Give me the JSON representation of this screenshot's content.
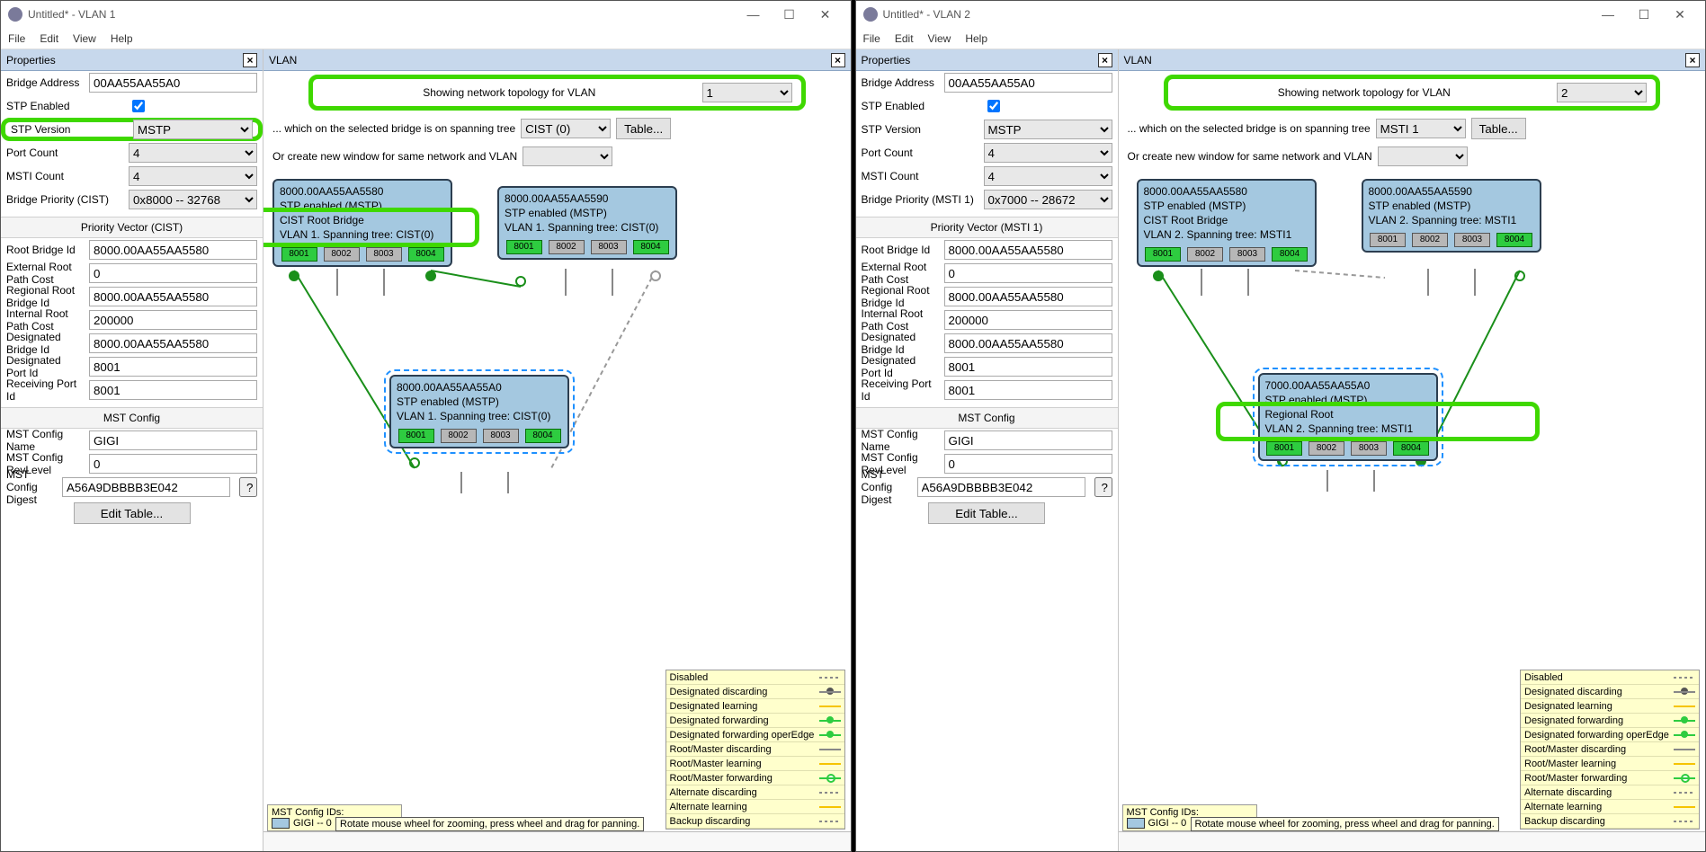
{
  "screens": [
    {
      "title": "Untitled* - VLAN 1",
      "menu": [
        "File",
        "Edit",
        "View",
        "Help"
      ],
      "props_title": "Properties",
      "props": {
        "bridge_address_lbl": "Bridge Address",
        "bridge_address": "00AA55AA55A0",
        "stp_enabled_lbl": "STP Enabled",
        "stp_enabled": true,
        "stp_version_lbl": "STP Version",
        "stp_version": "MSTP",
        "port_count_lbl": "Port Count",
        "port_count": "4",
        "msti_count_lbl": "MSTI Count",
        "msti_count": "4",
        "bridge_priority_lbl": "Bridge Priority (CIST)",
        "bridge_priority": "0x8000 -- 32768",
        "pv_hdr": "Priority Vector (CIST)",
        "root_bridge_id_lbl": "Root Bridge Id",
        "root_bridge_id": "8000.00AA55AA5580",
        "ext_root_path_lbl": "External Root Path Cost",
        "ext_root_path": "0",
        "reg_root_id_lbl": "Regional Root Bridge Id",
        "reg_root_id": "8000.00AA55AA5580",
        "int_root_path_lbl": "Internal Root Path Cost",
        "int_root_path": "200000",
        "desig_bridge_lbl": "Designated Bridge Id",
        "desig_bridge": "8000.00AA55AA5580",
        "desig_port_lbl": "Designated Port Id",
        "desig_port": "8001",
        "recv_port_lbl": "Receiving Port Id",
        "recv_port": "8001",
        "mst_hdr": "MST Config",
        "mst_name_lbl": "MST Config Name",
        "mst_name": "GIGI",
        "mst_rev_lbl": "MST Config RevLevel",
        "mst_rev": "0",
        "mst_digest_lbl": "MST Config Digest",
        "mst_digest": "A56A9DBBBB3E042",
        "edit_table": "Edit Table..."
      },
      "vlan_title": "VLAN",
      "vlan_top": {
        "showing": "Showing network topology for VLAN",
        "vlan_sel": "1",
        "which": "... which on the selected bridge is on spanning tree",
        "tree_sel": "CIST (0)",
        "table_btn": "Table...",
        "orcreate": "Or create new window for same network and VLAN"
      },
      "nodes": {
        "n1": {
          "id": "8000.00AA55AA5580",
          "stp": "STP enabled (MSTP)",
          "role": "CIST Root Bridge",
          "span": "VLAN 1. Spanning tree: CIST(0)",
          "ports": [
            "8001",
            "8002",
            "8003",
            "8004"
          ],
          "green": [
            0,
            3
          ]
        },
        "n2": {
          "id": "8000.00AA55AA5590",
          "stp": "STP enabled (MSTP)",
          "span": "VLAN 1. Spanning tree: CIST(0)",
          "ports": [
            "8001",
            "8002",
            "8003",
            "8004"
          ],
          "green": [
            0,
            3
          ]
        },
        "n3": {
          "id": "8000.00AA55AA55A0",
          "stp": "STP enabled (MSTP)",
          "span": "VLAN 1. Spanning tree: CIST(0)",
          "ports": [
            "8001",
            "8002",
            "8003",
            "8004"
          ],
          "green": [
            0,
            3
          ]
        }
      },
      "mst_ids_hdr": "MST Config IDs:",
      "mst_ids_item": "GIGI -- 0",
      "tooltip": "Rotate mouse wheel for zooming, press wheel and drag for panning."
    },
    {
      "title": "Untitled* - VLAN 2",
      "menu": [
        "File",
        "Edit",
        "View",
        "Help"
      ],
      "props_title": "Properties",
      "props": {
        "bridge_address_lbl": "Bridge Address",
        "bridge_address": "00AA55AA55A0",
        "stp_enabled_lbl": "STP Enabled",
        "stp_enabled": true,
        "stp_version_lbl": "STP Version",
        "stp_version": "MSTP",
        "port_count_lbl": "Port Count",
        "port_count": "4",
        "msti_count_lbl": "MSTI Count",
        "msti_count": "4",
        "bridge_priority_lbl": "Bridge Priority (MSTI 1)",
        "bridge_priority": "0x7000 -- 28672",
        "pv_hdr": "Priority Vector (MSTI 1)",
        "root_bridge_id_lbl": "Root Bridge Id",
        "root_bridge_id": "8000.00AA55AA5580",
        "ext_root_path_lbl": "External Root Path Cost",
        "ext_root_path": "0",
        "reg_root_id_lbl": "Regional Root Bridge Id",
        "reg_root_id": "8000.00AA55AA5580",
        "int_root_path_lbl": "Internal Root Path Cost",
        "int_root_path": "200000",
        "desig_bridge_lbl": "Designated Bridge Id",
        "desig_bridge": "8000.00AA55AA5580",
        "desig_port_lbl": "Designated Port Id",
        "desig_port": "8001",
        "recv_port_lbl": "Receiving Port Id",
        "recv_port": "8001",
        "mst_hdr": "MST Config",
        "mst_name_lbl": "MST Config Name",
        "mst_name": "GIGI",
        "mst_rev_lbl": "MST Config RevLevel",
        "mst_rev": "0",
        "mst_digest_lbl": "MST Config Digest",
        "mst_digest": "A56A9DBBBB3E042",
        "edit_table": "Edit Table..."
      },
      "vlan_title": "VLAN",
      "vlan_top": {
        "showing": "Showing network topology for VLAN",
        "vlan_sel": "2",
        "which": "... which on the selected bridge is on spanning tree",
        "tree_sel": "MSTI 1",
        "table_btn": "Table...",
        "orcreate": "Or create new window for same network and VLAN"
      },
      "nodes": {
        "n1": {
          "id": "8000.00AA55AA5580",
          "stp": "STP enabled (MSTP)",
          "role": "CIST Root Bridge",
          "span": "VLAN 2. Spanning tree: MSTI1",
          "ports": [
            "8001",
            "8002",
            "8003",
            "8004"
          ],
          "green": [
            0,
            3
          ]
        },
        "n2": {
          "id": "8000.00AA55AA5590",
          "stp": "STP enabled (MSTP)",
          "span": "VLAN 2. Spanning tree: MSTI1",
          "ports": [
            "8001",
            "8002",
            "8003",
            "8004"
          ],
          "green": [
            3
          ]
        },
        "n3": {
          "id": "7000.00AA55AA55A0",
          "stp": "STP enabled (MSTP)",
          "span": "VLAN 2. Spanning tree: MSTI1",
          "role": "Regional Root",
          "ports": [
            "8001",
            "8002",
            "8003",
            "8004"
          ],
          "green": [
            0,
            3
          ]
        }
      },
      "mst_ids_hdr": "MST Config IDs:",
      "mst_ids_item": "GIGI -- 0",
      "tooltip": "Rotate mouse wheel for zooming, press wheel and drag for panning."
    }
  ],
  "legend": [
    {
      "label": "Disabled",
      "sym": "gray-dash"
    },
    {
      "label": "Designated discarding",
      "sym": "gray-dot circ"
    },
    {
      "label": "Designated learning",
      "sym": "yellow"
    },
    {
      "label": "Designated forwarding",
      "sym": "green circ"
    },
    {
      "label": "Designated forwarding operEdge",
      "sym": "green circ"
    },
    {
      "label": "Root/Master discarding",
      "sym": "gray-dot"
    },
    {
      "label": "Root/Master learning",
      "sym": "yellow"
    },
    {
      "label": "Root/Master forwarding",
      "sym": "green circ open"
    },
    {
      "label": "Alternate discarding",
      "sym": "gray-dash"
    },
    {
      "label": "Alternate learning",
      "sym": "yellow"
    },
    {
      "label": "Backup discarding",
      "sym": "gray-dash"
    }
  ]
}
